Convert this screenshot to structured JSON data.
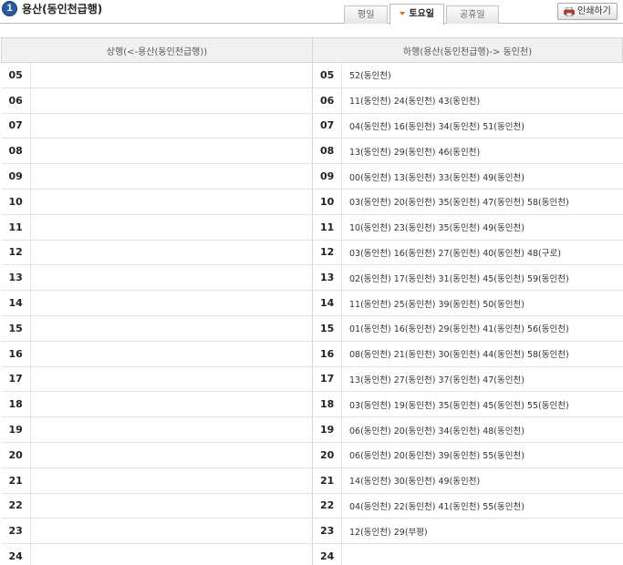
{
  "header": {
    "number": "1",
    "station": "용산(동인천급행)"
  },
  "tabs": [
    {
      "label": "평일",
      "active": false
    },
    {
      "label": "토요일",
      "active": true
    },
    {
      "label": "공휴일",
      "active": false
    }
  ],
  "print_button": {
    "label": "인쇄하기",
    "icon": "printer-icon"
  },
  "columns": {
    "up": "상행(<-용산(동인천급행))",
    "down": "하행(용산(동인천급행)-> 동인천)"
  },
  "rows": [
    {
      "hour": "05",
      "up": "",
      "down": "52(동인천)"
    },
    {
      "hour": "06",
      "up": "",
      "down": "11(동인천) 24(동인천) 43(동인천)"
    },
    {
      "hour": "07",
      "up": "",
      "down": "04(동인천) 16(동인천) 34(동인천) 51(동인천)"
    },
    {
      "hour": "08",
      "up": "",
      "down": "13(동인천) 29(동인천) 46(동인천)"
    },
    {
      "hour": "09",
      "up": "",
      "down": "00(동인천) 13(동인천) 33(동인천) 49(동인천)"
    },
    {
      "hour": "10",
      "up": "",
      "down": "03(동인천) 20(동인천) 35(동인천) 47(동인천) 58(동인천)"
    },
    {
      "hour": "11",
      "up": "",
      "down": "10(동인천) 23(동인천) 35(동인천) 49(동인천)"
    },
    {
      "hour": "12",
      "up": "",
      "down": "03(동인천) 16(동인천) 27(동인천) 40(동인천) 48(구로)"
    },
    {
      "hour": "13",
      "up": "",
      "down": "02(동인천) 17(동인천) 31(동인천) 45(동인천) 59(동인천)"
    },
    {
      "hour": "14",
      "up": "",
      "down": "11(동인천) 25(동인천) 39(동인천) 50(동인천)"
    },
    {
      "hour": "15",
      "up": "",
      "down": "01(동인천) 16(동인천) 29(동인천) 41(동인천) 56(동인천)"
    },
    {
      "hour": "16",
      "up": "",
      "down": "08(동인천) 21(동인천) 30(동인천) 44(동인천) 58(동인천)"
    },
    {
      "hour": "17",
      "up": "",
      "down": "13(동인천) 27(동인천) 37(동인천) 47(동인천)"
    },
    {
      "hour": "18",
      "up": "",
      "down": "03(동인천) 19(동인천) 35(동인천) 45(동인천) 55(동인천)"
    },
    {
      "hour": "19",
      "up": "",
      "down": "06(동인천) 20(동인천) 34(동인천) 48(동인천)"
    },
    {
      "hour": "20",
      "up": "",
      "down": "06(동인천) 20(동인천) 39(동인천) 55(동인천)"
    },
    {
      "hour": "21",
      "up": "",
      "down": "14(동인천) 30(동인천) 49(동인천)"
    },
    {
      "hour": "22",
      "up": "",
      "down": "04(동인천) 22(동인천) 41(동인천) 55(동인천)"
    },
    {
      "hour": "23",
      "up": "",
      "down": "12(동인천) 29(부평)"
    },
    {
      "hour": "24",
      "up": "",
      "down": ""
    }
  ]
}
